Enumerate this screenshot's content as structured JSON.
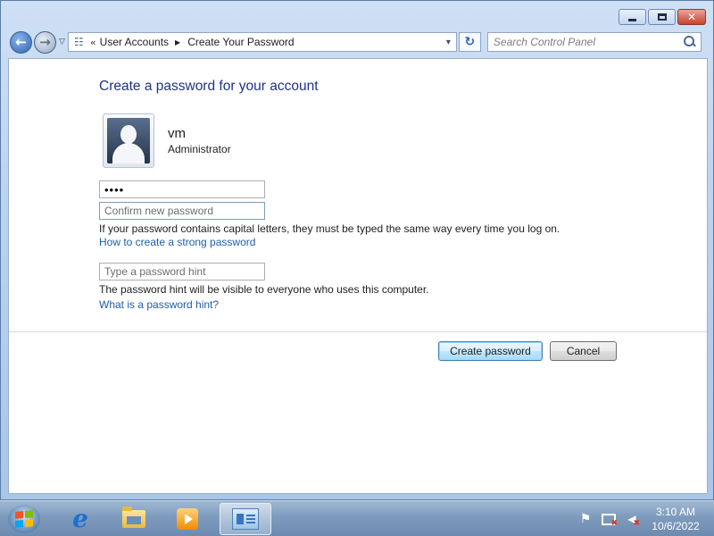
{
  "window": {
    "minimize_glyph": "minimize-icon",
    "maximize_glyph": "maximize-icon",
    "close_glyph": "close-icon"
  },
  "navbar": {
    "back_glyph": "←",
    "forward_glyph": "→",
    "history_glyph": "▽",
    "chevrons": "«",
    "breadcrumb": [
      "User Accounts",
      "Create Your Password"
    ],
    "crumb_separator": "▶",
    "address_dropdown_glyph": "▾",
    "refresh_glyph": "↻",
    "search_placeholder": "Search Control Panel"
  },
  "content": {
    "title": "Create a password for your account",
    "user": {
      "name": "vm",
      "role": "Administrator"
    },
    "fields": {
      "new_password_value": "••••",
      "confirm_placeholder": "Confirm new password",
      "hint_placeholder": "Type a password hint"
    },
    "caps_note": "If your password contains capital letters, they must be typed the same way every time you log on.",
    "strong_password_link": "How to create a strong password",
    "hint_note": "The password hint will be visible to everyone who uses this computer.",
    "hint_link": "What is a password hint?",
    "create_button": "Create password",
    "cancel_button": "Cancel"
  },
  "taskbar": {
    "items": [
      "start-orb",
      "internet-explorer",
      "windows-explorer",
      "windows-media-player",
      "control-panel"
    ],
    "active_item": "control-panel",
    "clock_time": "3:10 AM",
    "clock_date": "10/6/2022"
  },
  "colors": {
    "title": "#1e3287",
    "link": "#1f5ea8",
    "close_button": "#c7432f"
  }
}
